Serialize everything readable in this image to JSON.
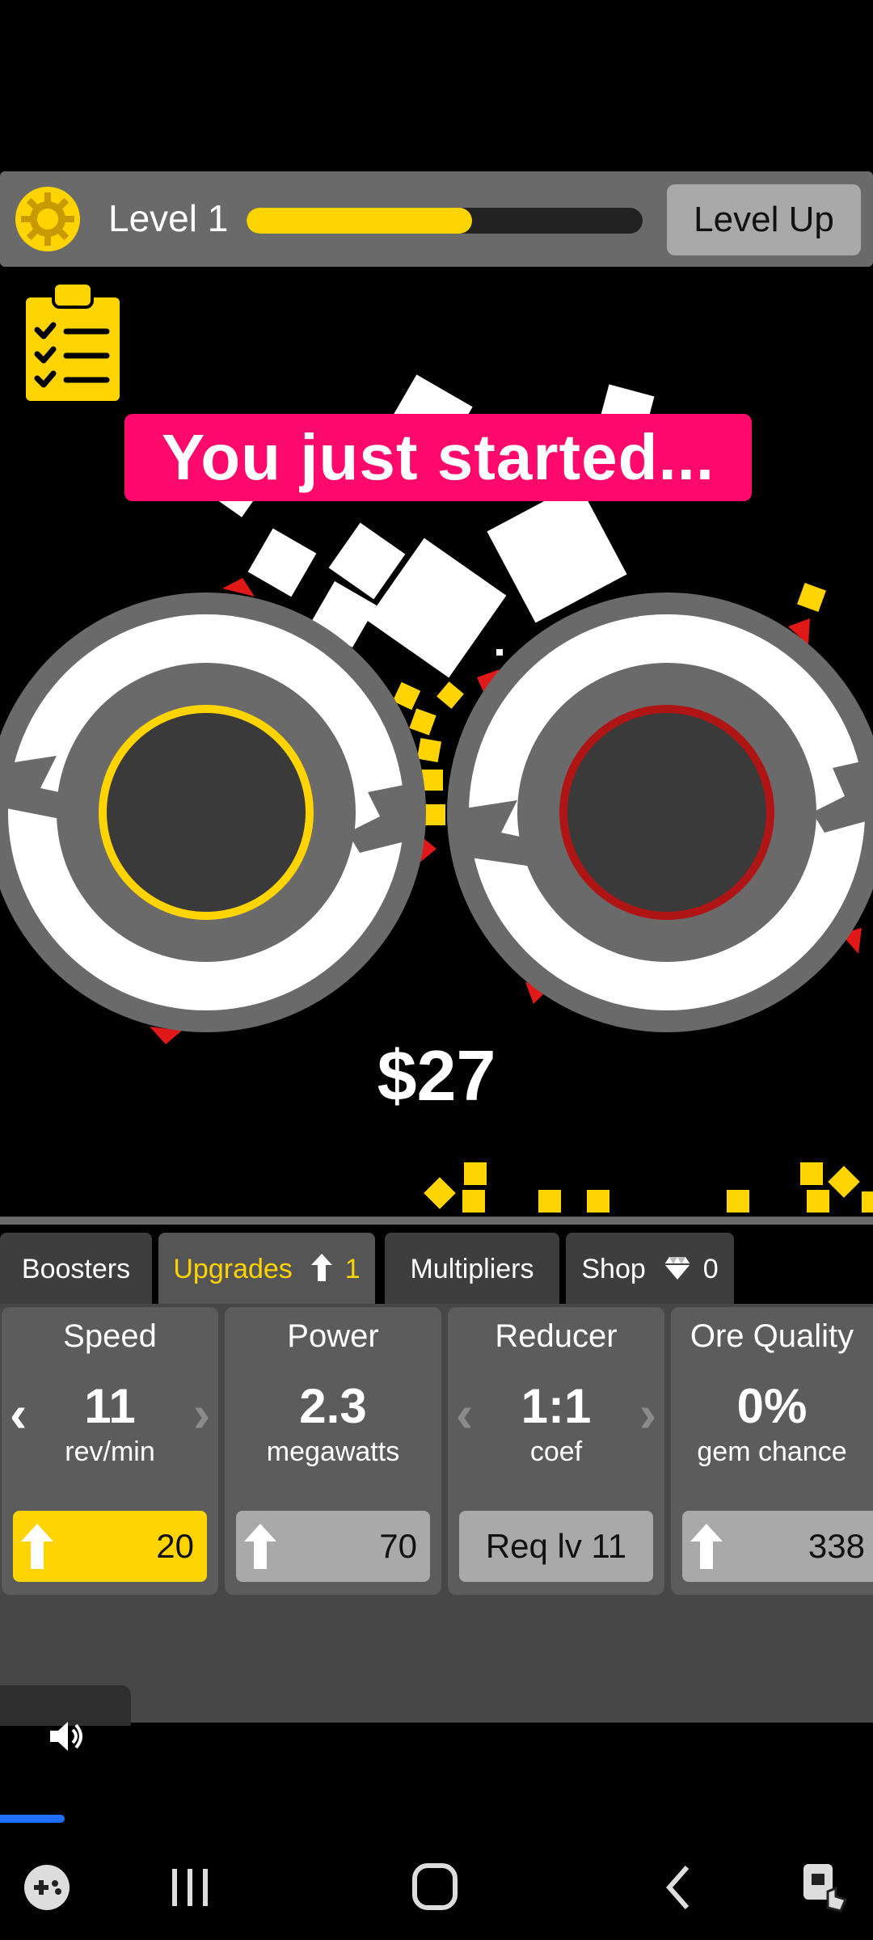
{
  "top_bar": {
    "level_label": "Level 1",
    "level_progress": 0.57,
    "level_up_label": "Level Up"
  },
  "banner": {
    "text": "You just started..."
  },
  "money": {
    "text": "$27"
  },
  "tabs": [
    {
      "label": "Boosters"
    },
    {
      "label": "Upgrades",
      "badge": "1",
      "icon": "up-arrow-icon"
    },
    {
      "label": "Multipliers"
    },
    {
      "label": "Shop",
      "badge": "0",
      "icon": "gem-icon"
    }
  ],
  "cards": [
    {
      "title": "Speed",
      "value": "11",
      "unit": "rev/min",
      "button": "20"
    },
    {
      "title": "Power",
      "value": "2.3",
      "unit": "megawatts",
      "button": "70"
    },
    {
      "title": "Reducer",
      "value": "1:1",
      "unit": "coef",
      "button": "Req lv 11"
    },
    {
      "title": "Ore Quality",
      "value": "0%",
      "unit": "gem chance",
      "button": "338"
    }
  ],
  "colors": {
    "accent_yellow": "#ffd400",
    "banner_pink": "#ff0a6c",
    "ring_red": "#b01515"
  }
}
